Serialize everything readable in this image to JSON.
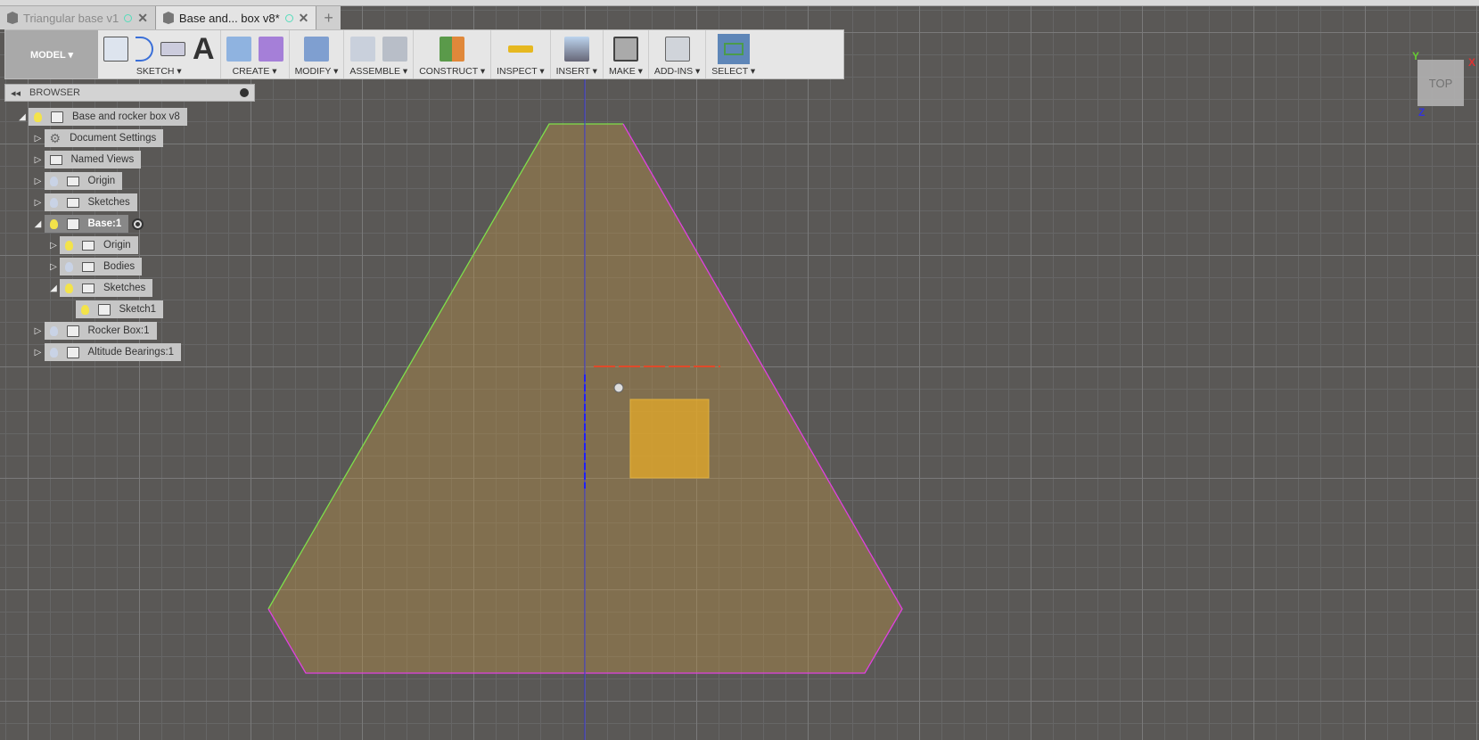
{
  "tabs": [
    {
      "label": "Triangular base v1",
      "active": false
    },
    {
      "label": "Base and... box v8*",
      "active": true
    }
  ],
  "new_tab": "+",
  "toolbar": {
    "workspace": "MODEL ▾",
    "groups": [
      "SKETCH ▾",
      "CREATE ▾",
      "MODIFY ▾",
      "ASSEMBLE ▾",
      "CONSTRUCT ▾",
      "INSPECT ▾",
      "INSERT ▾",
      "MAKE ▾",
      "ADD-INS ▾",
      "SELECT ▾"
    ]
  },
  "browser": {
    "title": "BROWSER",
    "nodes": [
      {
        "label": "Base and rocker box v8",
        "icon": "component-icon",
        "bulb": "on",
        "expanded": true
      },
      {
        "label": "Document Settings",
        "icon": "gear-icon",
        "bulb": "none",
        "expanded": false
      },
      {
        "label": "Named Views",
        "icon": "folder-icon",
        "bulb": "none",
        "expanded": false
      },
      {
        "label": "Origin",
        "icon": "folder-icon",
        "bulb": "off",
        "expanded": false
      },
      {
        "label": "Sketches",
        "icon": "folder-icon",
        "bulb": "off",
        "expanded": false
      },
      {
        "label": "Base:1",
        "icon": "body-icon",
        "bulb": "on",
        "expanded": true,
        "active": true
      },
      {
        "label": "Origin",
        "icon": "folder-icon",
        "bulb": "on",
        "expanded": false
      },
      {
        "label": "Bodies",
        "icon": "folder-icon",
        "bulb": "off",
        "expanded": false
      },
      {
        "label": "Sketches",
        "icon": "folder-icon",
        "bulb": "on",
        "expanded": true
      },
      {
        "label": "Sketch1",
        "icon": "sketch-icon",
        "bulb": "on",
        "expanded": null
      },
      {
        "label": "Rocker Box:1",
        "icon": "component-icon",
        "bulb": "off",
        "expanded": false
      },
      {
        "label": "Altitude Bearings:1",
        "icon": "component-icon",
        "bulb": "off",
        "expanded": false
      }
    ]
  },
  "viewcube": {
    "face": "TOP",
    "x": "X",
    "y": "Y",
    "z": "Z"
  },
  "colors": {
    "accent": "#5e86b8",
    "profile_fill": "#a08a5a",
    "selected_fill": "#d9a32a",
    "edge_green": "#7fe04a",
    "edge_magenta": "#e040e0"
  }
}
